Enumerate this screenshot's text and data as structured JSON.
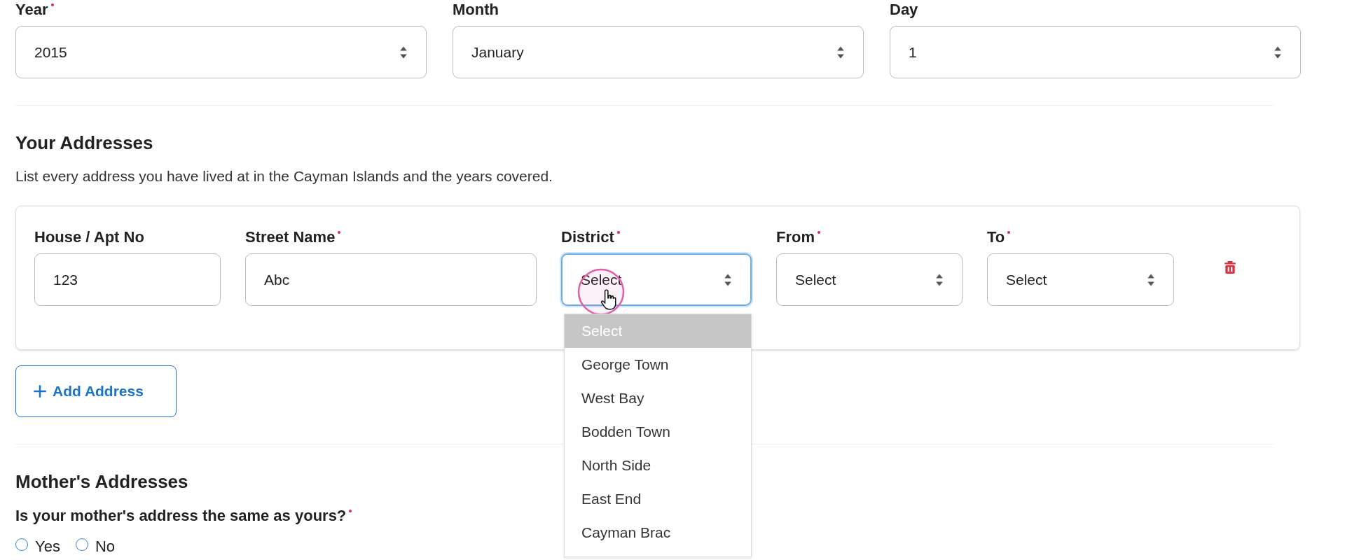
{
  "date_fields": [
    {
      "label": "Year",
      "required": true,
      "value": "2015"
    },
    {
      "label": "Month",
      "required": false,
      "value": "January"
    },
    {
      "label": "Day",
      "required": false,
      "value": "1"
    }
  ],
  "your_addresses": {
    "title": "Your Addresses",
    "description": "List every address you have lived at in the Cayman Islands and the years covered.",
    "address_fields": [
      {
        "kind": "text",
        "label": "House / Apt No",
        "required": false,
        "value": "123",
        "focused": false
      },
      {
        "kind": "text",
        "label": "Street Name",
        "required": true,
        "value": "Abc",
        "focused": false
      },
      {
        "kind": "select",
        "label": "District",
        "required": true,
        "value": "Select",
        "focused": true
      },
      {
        "kind": "select",
        "label": "From",
        "required": true,
        "value": "Select",
        "focused": false
      },
      {
        "kind": "select",
        "label": "To",
        "required": true,
        "value": "Select",
        "focused": false
      }
    ],
    "district_options": [
      {
        "label": "Select",
        "selected": true
      },
      {
        "label": "George Town",
        "selected": false
      },
      {
        "label": "West Bay",
        "selected": false
      },
      {
        "label": "Bodden Town",
        "selected": false
      },
      {
        "label": "North Side",
        "selected": false
      },
      {
        "label": "East End",
        "selected": false
      },
      {
        "label": "Cayman Brac",
        "selected": false
      }
    ],
    "add_button": "Add Address"
  },
  "mothers_addresses": {
    "title": "Mother's Addresses",
    "question": "Is your mother's address the same as yours?",
    "required": true,
    "options": [
      {
        "label": "Yes",
        "selected": false
      },
      {
        "label": "No",
        "selected": false
      }
    ]
  }
}
